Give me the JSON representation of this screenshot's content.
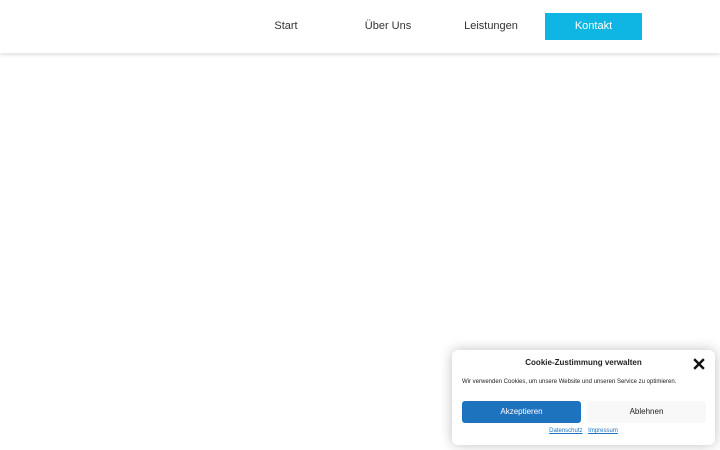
{
  "nav": {
    "items": [
      {
        "label": "Start"
      },
      {
        "label": "Über Uns"
      },
      {
        "label": "Leistungen"
      },
      {
        "label": "Kontakt"
      }
    ],
    "active_bg": "#0fb6e3"
  },
  "cookie": {
    "title": "Cookie-Zustimmung verwalten",
    "text": "Wir verwenden Cookies, um unsere Website und unseren Service zu optimieren.",
    "accept_label": "Akzeptieren",
    "deny_label": "Ablehnen",
    "links": [
      {
        "label": "Datenschutz"
      },
      {
        "label": "Impressum"
      }
    ],
    "close_icon": "close-icon",
    "accent": "#1e73be"
  }
}
